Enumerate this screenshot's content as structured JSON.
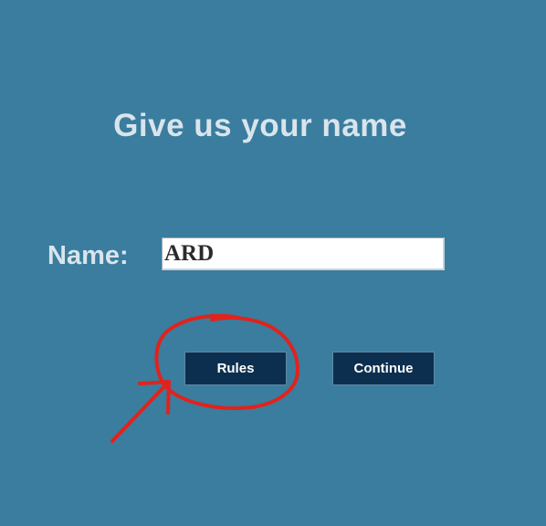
{
  "page": {
    "title": "Give us your name"
  },
  "form": {
    "name_label": "Name:",
    "name_value": "ARD"
  },
  "buttons": {
    "rules_label": "Rules",
    "continue_label": "Continue"
  },
  "annotation": {
    "color": "#e0231c",
    "shapes": [
      "circle-around-rules-button",
      "arrow-pointing-to-rules-button"
    ]
  },
  "colors": {
    "background": "#3a7d9e",
    "text": "#d9e4ec",
    "button": "#0d2f4f"
  }
}
